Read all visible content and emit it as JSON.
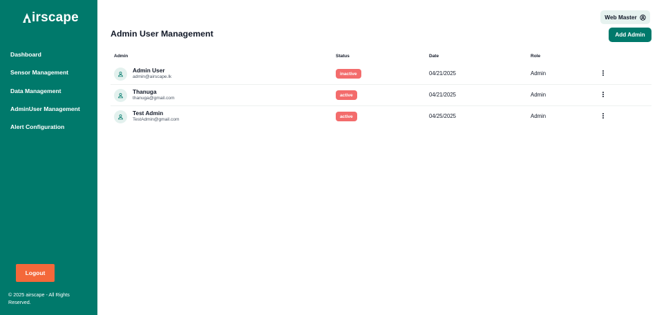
{
  "brand": {
    "name": "irscape"
  },
  "sidebar": {
    "items": [
      {
        "label": "Dashboard"
      },
      {
        "label": "Sensor Management"
      },
      {
        "label": "Data Management"
      },
      {
        "label": "AdminUser Management"
      },
      {
        "label": "Alert Configuration"
      }
    ],
    "logout_label": "Logout",
    "copyright": "© 2025 airscape - All Rights Reserved."
  },
  "header": {
    "user_label": "Web Master",
    "user_icon": "user-circle-icon",
    "title": "Admin User Management",
    "add_button_label": "Add Admin"
  },
  "table": {
    "columns": [
      "Admin",
      "Status",
      "Date",
      "Role"
    ],
    "rows": [
      {
        "name": "Admin User",
        "email": "admin@airscape.lk",
        "status": "inactive",
        "date": "04/21/2025",
        "role": "Admin"
      },
      {
        "name": "Thanuga",
        "email": "thanuga@gmail.com",
        "status": "active",
        "date": "04/21/2025",
        "role": "Admin"
      },
      {
        "name": "Test Admin",
        "email": "TestAdmin@gmail.com",
        "status": "active",
        "date": "04/25/2025",
        "role": "Admin"
      }
    ]
  },
  "colors": {
    "sidebar": "#00796b",
    "primary": "#00796b",
    "logout": "#f4683a",
    "badge": "#f36c6c",
    "chip": "#e6f2ef"
  }
}
